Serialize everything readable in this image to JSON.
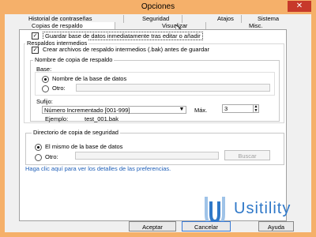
{
  "window": {
    "title": "Opciones",
    "close_glyph": "✕"
  },
  "tabs_row1": [
    {
      "label": "Historial de contraseñas"
    },
    {
      "label": "Seguridad"
    },
    {
      "label": "Atajos"
    },
    {
      "label": "Sistema"
    }
  ],
  "tabs_row2": [
    {
      "label": "Copias de respaldo"
    },
    {
      "label": "Visualizar"
    },
    {
      "label": "Misc."
    }
  ],
  "save_after_edit": {
    "label": "Guardar base de datos inmediatamente tras editar o añadir",
    "checked": true
  },
  "intermediate_backups": {
    "group_label": "Respaldos intermedios",
    "create_checkbox": {
      "label": "Crear archivos de respaldo intermedios (.bak) antes de guardar",
      "checked": true
    },
    "name_group": {
      "label": "Nombre de copia de respaldo",
      "base_label": "Base:",
      "base_options": [
        {
          "label": "Nombre de la base de datos",
          "selected": true
        },
        {
          "label": "Otro:",
          "selected": false
        }
      ],
      "suffix_label": "Sufijo:",
      "suffix_value": "Número Incrementado [001-999]",
      "max_label": "Máx.",
      "max_value": "3",
      "example_label": "Ejemplo:",
      "example_value": "test_001.bak"
    }
  },
  "backup_dir": {
    "label": "Directorio de copia de seguridad",
    "options": [
      {
        "label": "El mismo de la base de datos",
        "selected": true
      },
      {
        "label": "Otro:",
        "selected": false
      }
    ],
    "browse_label": "Buscar"
  },
  "help_link": "Haga clic aquí para ver los detalles de las preferencias.",
  "buttons": {
    "ok": "Aceptar",
    "cancel": "Cancelar",
    "help": "Ayuda"
  },
  "watermark": {
    "text": "Usitility"
  },
  "colors": {
    "title_bar": "#f5b06a",
    "close": "#c7392a",
    "link": "#1f5fb8",
    "logo_blue": "#2f78c8"
  }
}
